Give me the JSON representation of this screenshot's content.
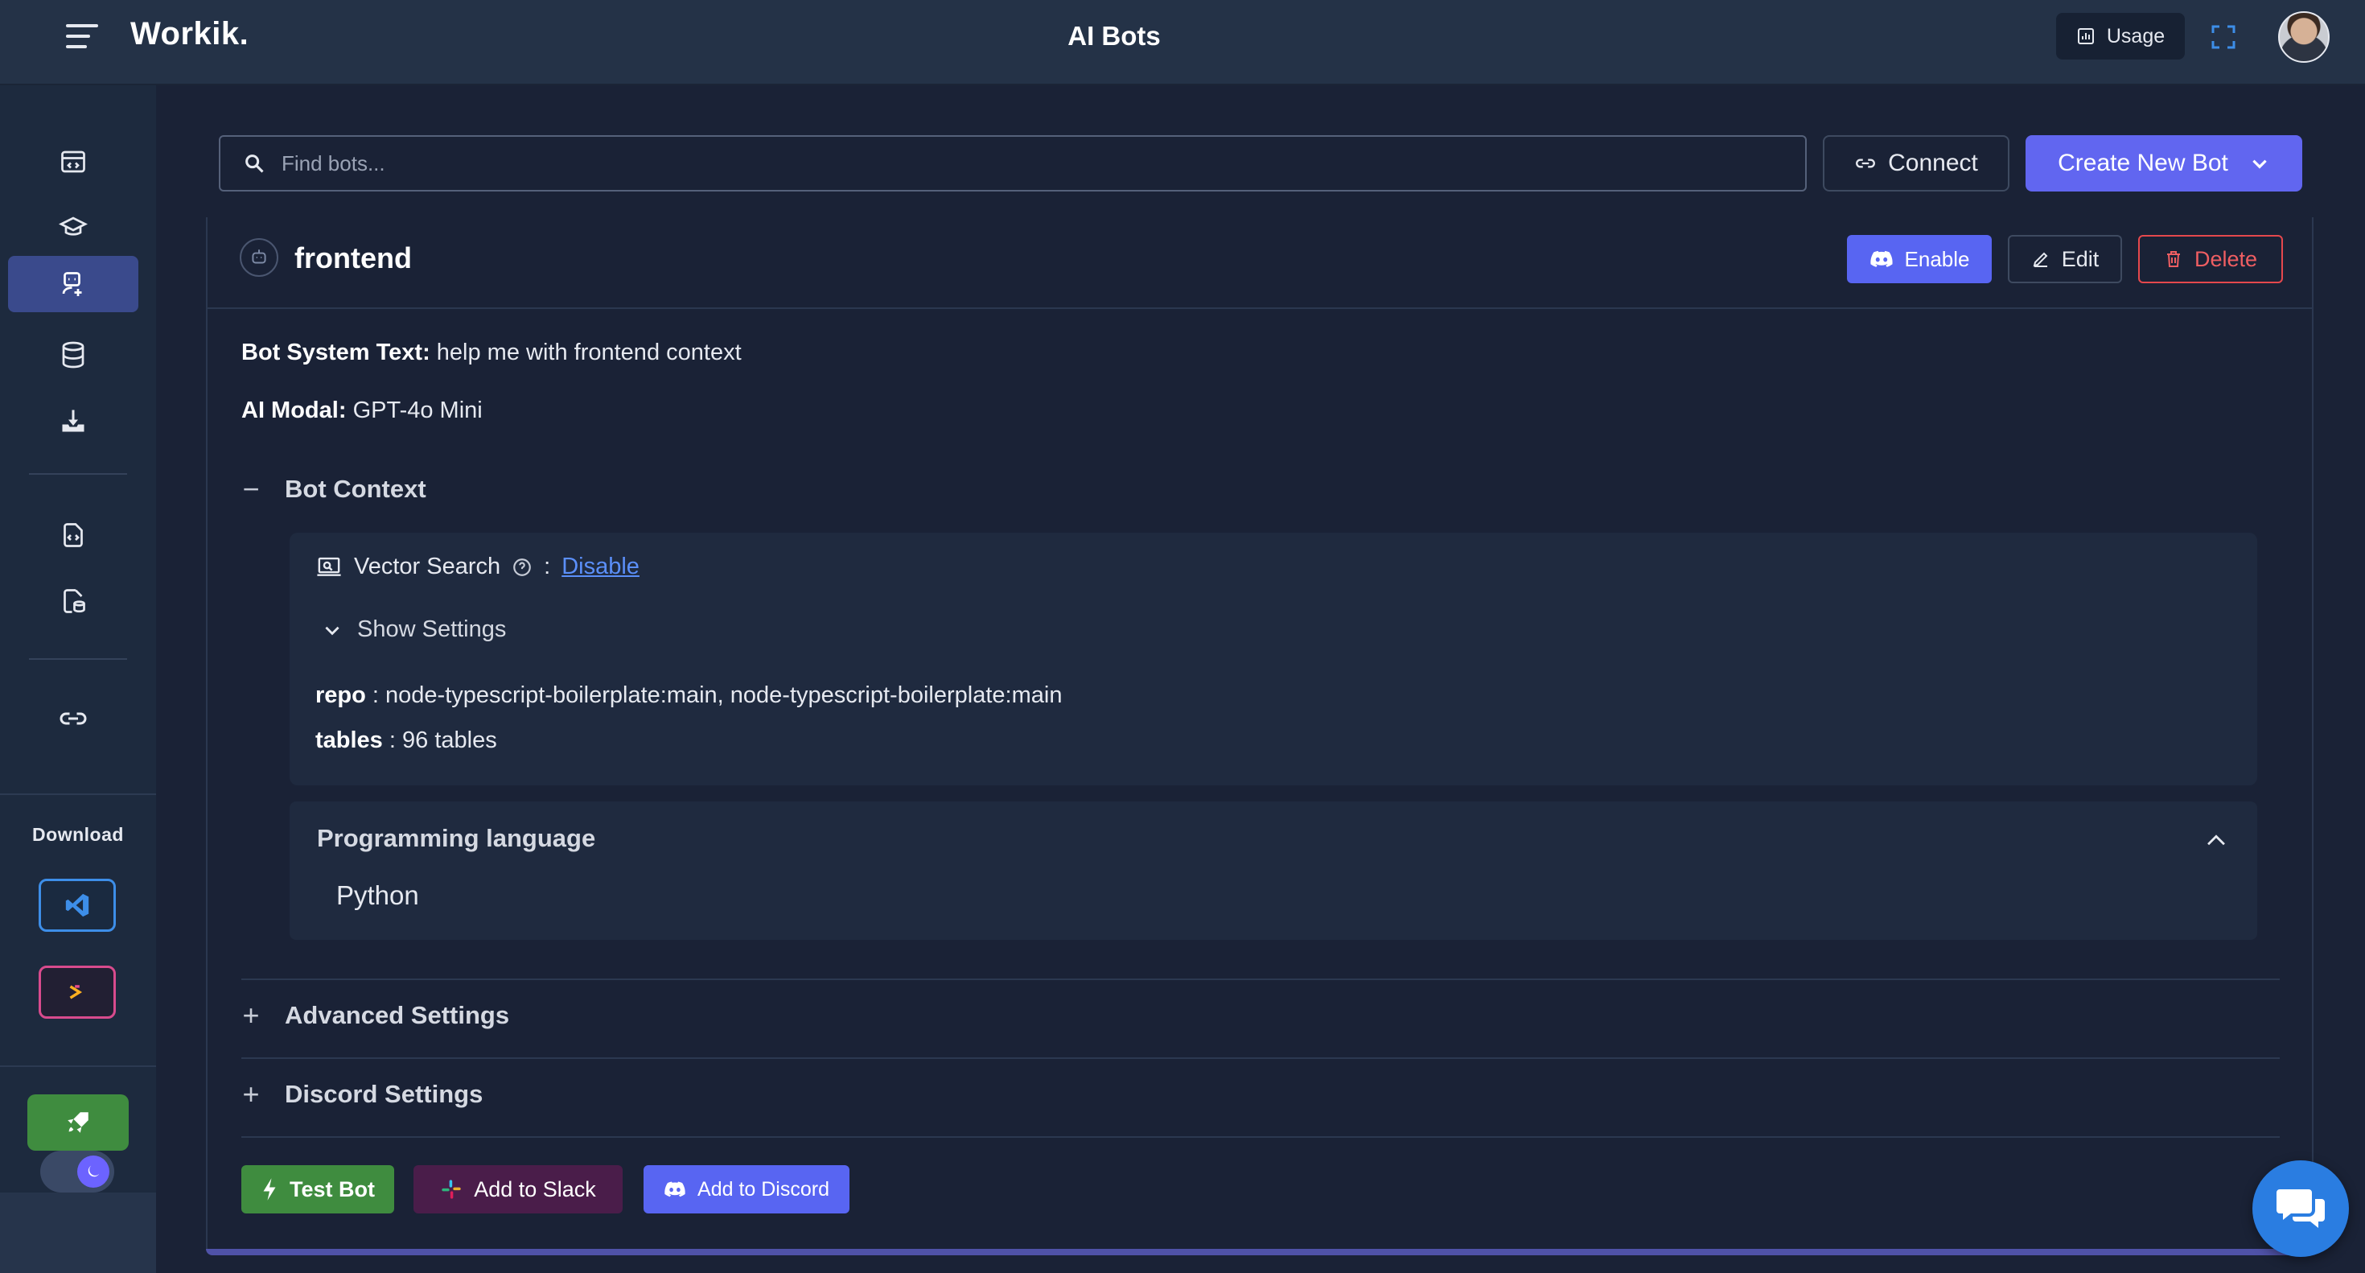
{
  "header": {
    "brand": "Workik.",
    "title": "AI Bots",
    "usage_label": "Usage"
  },
  "sidebar": {
    "download_label": "Download"
  },
  "toolbar": {
    "search_placeholder": "Find bots...",
    "connect_label": "Connect",
    "create_label": "Create New Bot"
  },
  "bot": {
    "name": "frontend",
    "enable_label": "Enable",
    "edit_label": "Edit",
    "delete_label": "Delete",
    "system_text_key": "Bot System Text:",
    "system_text_value": "help me with frontend context",
    "model_key": "AI Modal:",
    "model_value": "GPT-4o Mini",
    "context_section": {
      "sign": "−",
      "label": "Bot Context",
      "vector_search_label": "Vector Search",
      "vector_search_sep": ":",
      "vector_search_link": "Disable",
      "show_settings_label": "Show Settings",
      "repo_key": "repo",
      "repo_value": ": node-typescript-boilerplate:main, node-typescript-boilerplate:main",
      "tables_key": "tables",
      "tables_value": ": 96 tables"
    },
    "language_panel": {
      "title": "Programming language",
      "value": "Python"
    },
    "advanced_section": {
      "sign": "+",
      "label": "Advanced Settings"
    },
    "discord_section": {
      "sign": "+",
      "label": "Discord Settings"
    },
    "actions": {
      "test_label": "Test Bot",
      "slack_label": "Add to Slack",
      "discord_label": "Add to Discord"
    }
  },
  "colors": {
    "accent": "#6166f0",
    "discord": "#5865f2",
    "success": "#3f8c3f",
    "danger": "#e5484d",
    "link": "#5b8ff9"
  }
}
